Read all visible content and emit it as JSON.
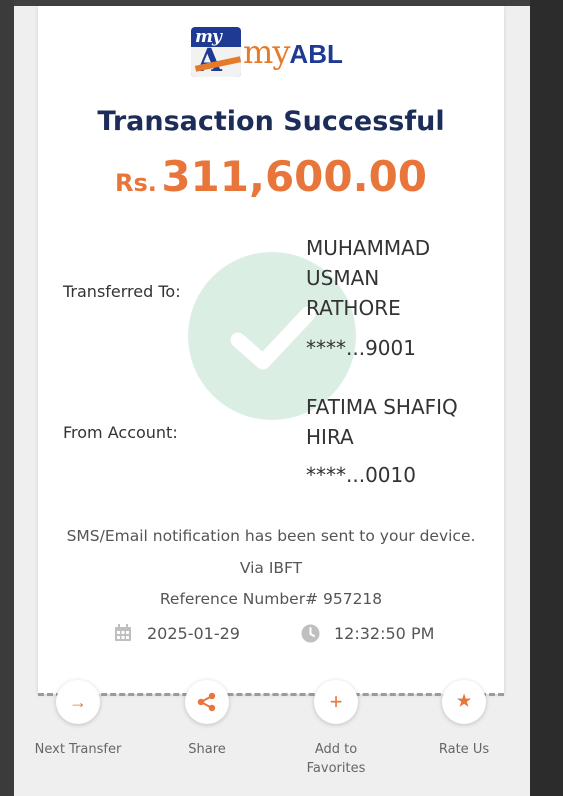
{
  "header": {
    "logo_badge_text": "my",
    "logo_badge_letter": "A",
    "logo_text_my": "my",
    "logo_text_abl": "ABL"
  },
  "title": "Transaction Successful",
  "amount": {
    "currency": "Rs.",
    "value": "311,600.00"
  },
  "transfer": {
    "to_label": "Transferred To:",
    "to_name": "MUHAMMAD USMAN RATHORE",
    "to_account": "****...9001",
    "from_label": "From Account:",
    "from_name": "FATIMA SHAFIQ HIRA",
    "from_account": "****...0010"
  },
  "notice": "SMS/Email notification has been sent to your device.",
  "via": "Via IBFT",
  "reference": "Reference Number# 957218",
  "date": "2025-01-29",
  "time": "12:32:50 PM",
  "icons": {
    "date": "calendar-icon",
    "time": "clock-icon",
    "watermark": "checkmark-icon",
    "next_transfer": "arrow-right-icon",
    "share": "share-icon",
    "favorites": "plus-icon",
    "rate": "star-icon"
  },
  "colors": {
    "accent": "#e8753a",
    "navy": "#1d2d5a",
    "brand_blue": "#1f3a93",
    "success_light": "#dbeee3"
  },
  "actions": [
    {
      "label": "Next Transfer",
      "glyph": "→"
    },
    {
      "label": "Share",
      "glyph": ""
    },
    {
      "label": "Add to Favorites",
      "glyph": "+"
    },
    {
      "label": "Rate Us",
      "glyph": "★"
    }
  ]
}
